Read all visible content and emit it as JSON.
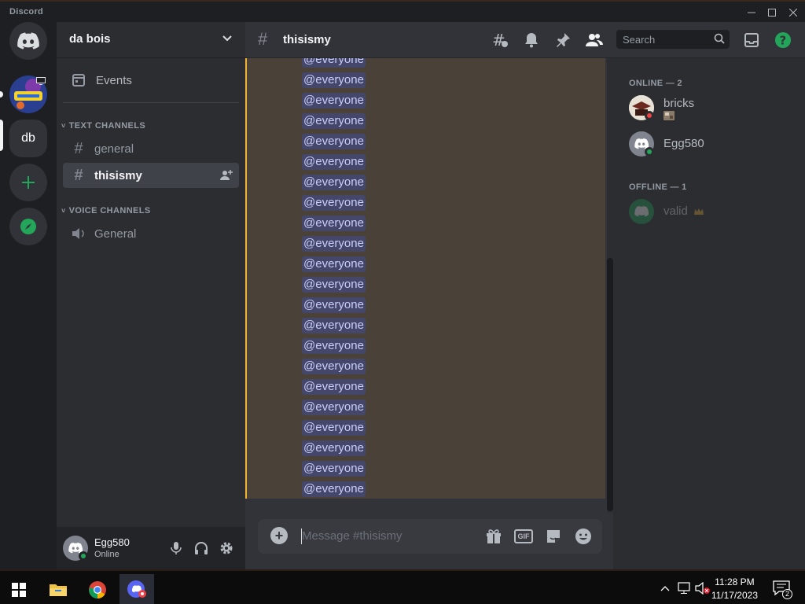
{
  "window": {
    "app_name": "Discord"
  },
  "rail": {
    "servers": [
      {
        "label": "Direct Messages"
      },
      {
        "label": "SpongeBob server"
      },
      {
        "label": "db",
        "color": "#5865f2"
      },
      {
        "label": "Add a Server",
        "color": "#23a55a"
      },
      {
        "label": "Explore Discoverable Servers",
        "color": "#23a55a"
      }
    ]
  },
  "guild": {
    "name": "da bois",
    "events_label": "Events",
    "categories": {
      "text": "TEXT CHANNELS",
      "voice": "VOICE CHANNELS"
    },
    "text_channels": [
      {
        "name": "general",
        "active": false
      },
      {
        "name": "thisismy",
        "active": true
      }
    ],
    "voice_channels": [
      {
        "name": "General"
      }
    ]
  },
  "user": {
    "name": "Egg580",
    "status": "Online"
  },
  "chat": {
    "channel": "thisismy",
    "search_placeholder": "Search",
    "composer_placeholder": "Message #thisismy",
    "messages": [
      "@everyone",
      "@everyone",
      "@everyone",
      "@everyone",
      "@everyone",
      "@everyone",
      "@everyone",
      "@everyone",
      "@everyone",
      "@everyone",
      "@everyone",
      "@everyone",
      "@everyone",
      "@everyone",
      "@everyone",
      "@everyone",
      "@everyone",
      "@everyone",
      "@everyone",
      "@everyone",
      "@everyone",
      "@everyone"
    ],
    "gif_label": "GIF"
  },
  "members": {
    "online_label": "ONLINE — 2",
    "offline_label": "OFFLINE — 1",
    "online": [
      {
        "name": "bricks",
        "status": "dnd",
        "has_activity_icon": true
      },
      {
        "name": "Egg580",
        "status": "online"
      }
    ],
    "offline": [
      {
        "name": "valid",
        "owner": true
      }
    ]
  },
  "taskbar": {
    "time": "11:28 PM",
    "date": "11/17/2023",
    "notification_count": "2"
  },
  "colors": {
    "blurple": "#5865f2",
    "green": "#23a55a",
    "mention_bg": "#45476a",
    "highlight_bar": "#f0b232",
    "dnd_red": "#f23f43",
    "help_green": "#23a55a"
  }
}
